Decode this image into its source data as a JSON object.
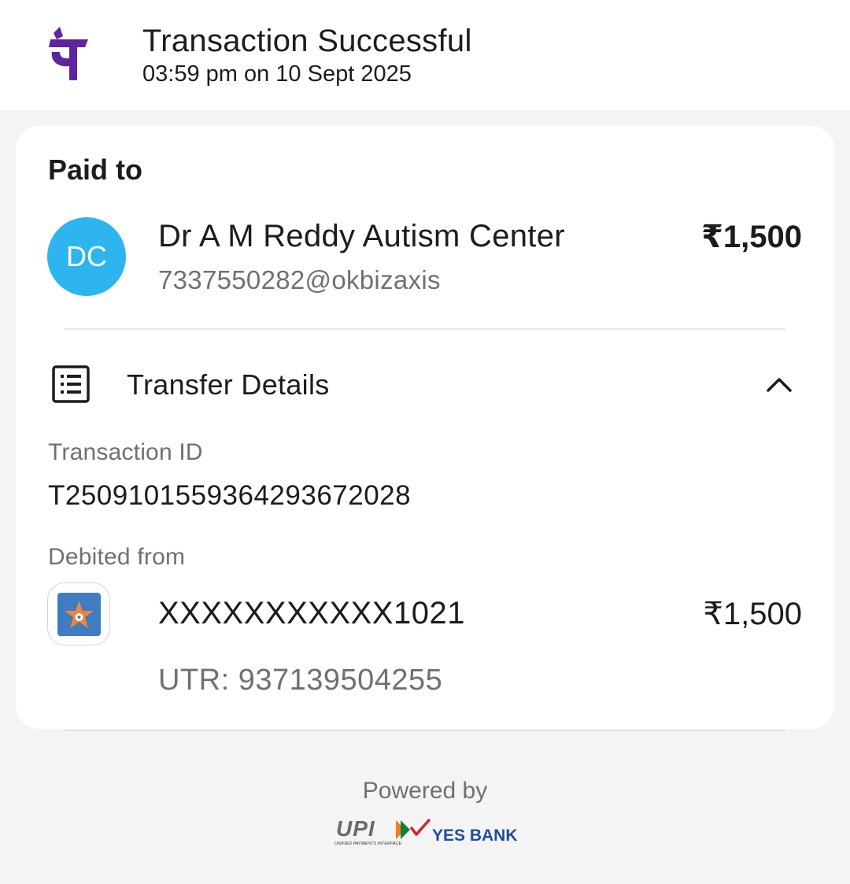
{
  "header": {
    "logo_icon": "phonepe-logo",
    "title": "Transaction Successful",
    "subtitle": "03:59 pm on 10 Sept 2025"
  },
  "paid_to": {
    "label": "Paid to",
    "avatar_initials": "DC",
    "avatar_color": "#2eb5f0",
    "name": "Dr A M Reddy Autism Center",
    "vpa": "7337550282@okbizaxis",
    "amount": "₹1,500"
  },
  "transfer_details": {
    "icon": "receipt-list-icon",
    "title": "Transfer Details",
    "toggle_icon": "chevron-up-icon",
    "transaction_id_label": "Transaction ID",
    "transaction_id": "T2509101559364293672028",
    "debited_from_label": "Debited from",
    "bank_icon": "bank-star-logo",
    "account_number": "XXXXXXXXXXX1021",
    "debit_amount": "₹1,500",
    "utr": "UTR: 937139504255"
  },
  "footer": {
    "powered_by": "Powered by",
    "upi_logo_text": "UPI",
    "upi_tagline": "UNIFIED PAYMENTS INTERFACE",
    "bank_logo_text": "YES BANK"
  },
  "colors": {
    "brand_purple": "#5f259f",
    "avatar_blue": "#2eb5f0",
    "yes_bank_blue": "#1e4c9a",
    "yes_bank_red": "#e11f26"
  }
}
